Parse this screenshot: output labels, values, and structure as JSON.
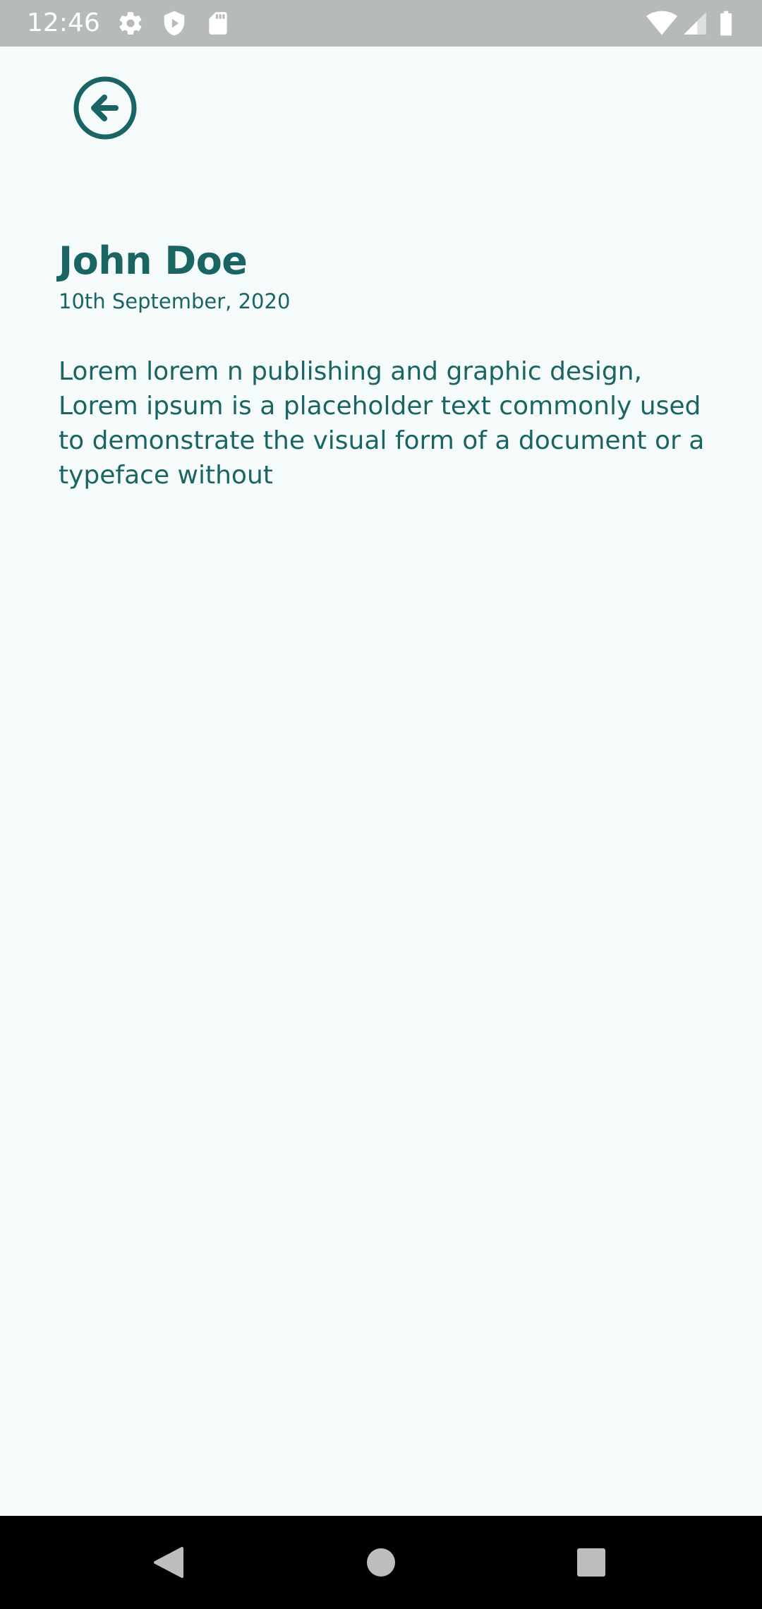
{
  "status_bar": {
    "time": "12:46",
    "icons": [
      "gear-icon",
      "shield-play-icon",
      "sd-card-icon",
      "wifi-icon",
      "signal-icon",
      "battery-icon"
    ],
    "background": "#b7babb"
  },
  "header": {
    "back_icon": "arrow-left-circle-icon"
  },
  "article": {
    "title": "John Doe",
    "date": "10th September, 2020",
    "body": "Lorem lorem n publishing and graphic design, Lorem ipsum is a placeholder text commonly used to demonstrate the visual form of a document or a typeface without"
  },
  "nav_bar": {
    "icons": [
      "back-triangle-icon",
      "home-circle-icon",
      "recents-square-icon"
    ]
  },
  "colors": {
    "accent": "#1a6463",
    "background": "#f4fbfa",
    "nav_background": "#000000"
  }
}
